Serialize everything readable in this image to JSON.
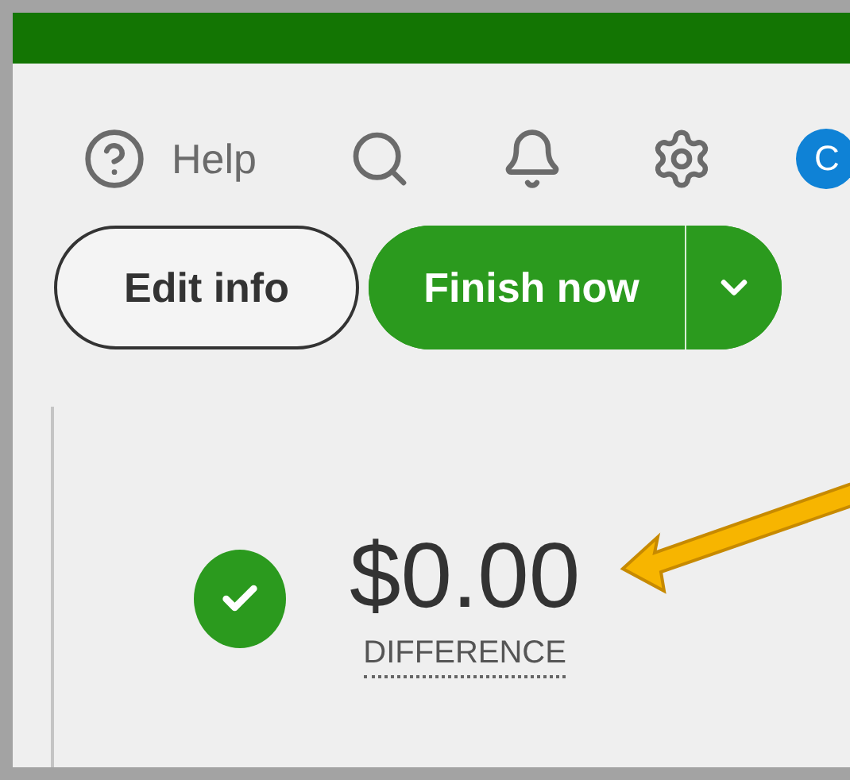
{
  "toolbar": {
    "help_label": "Help",
    "avatar_initial": "C"
  },
  "actions": {
    "edit_button": "Edit info",
    "primary_button": "Finish now"
  },
  "summary": {
    "balanced": true,
    "amount": "$0.00",
    "label": "DIFFERENCE"
  }
}
